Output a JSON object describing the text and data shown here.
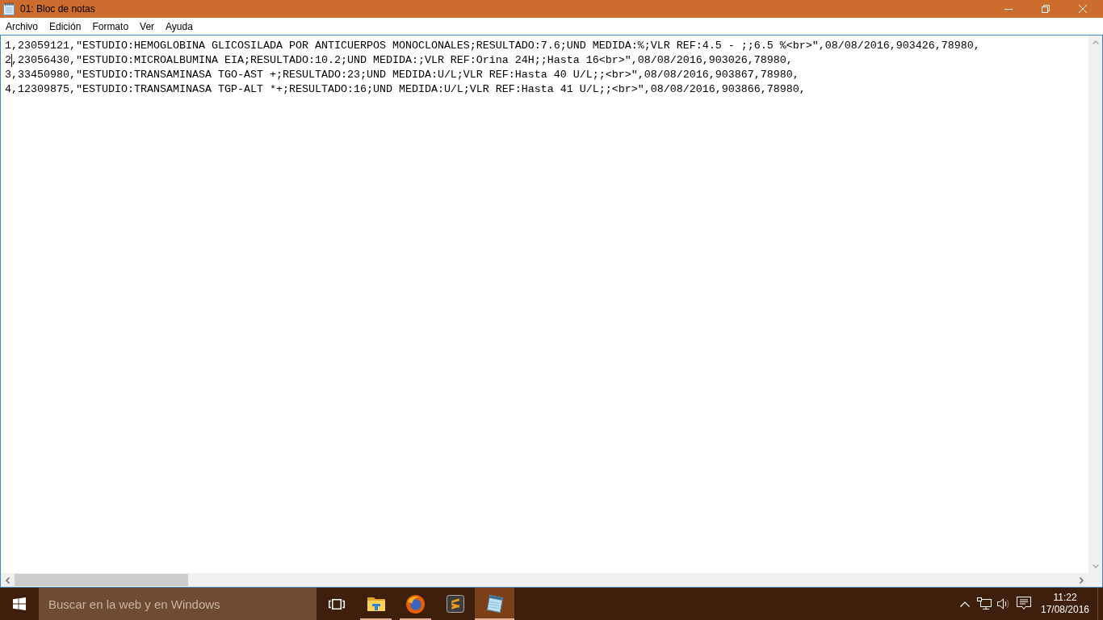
{
  "window": {
    "title": "01: Bloc de notas"
  },
  "menu": [
    "Archivo",
    "Edición",
    "Formato",
    "Ver",
    "Ayuda"
  ],
  "document": {
    "lines": [
      {
        "text": "1,23059121,\"ESTUDIO:HEMOGLOBINA GLICOSILADA POR ANTICUERPOS MONOCLONALES;RESULTADO:7.6;UND MEDIDA:%;VLR REF:4.5 - ;;6.5 %<br>\",08/08/2016,903426,78980,",
        "caret": false
      },
      {
        "text": "2,23056430,\"ESTUDIO:MICROALBUMINA EIA;RESULTADO:10.2;UND MEDIDA:;VLR REF:Orina 24H;;Hasta 16<br>\",08/08/2016,903026,78980,",
        "caret": true
      },
      {
        "text": "3,33450980,\"ESTUDIO:TRANSAMINASA TGO-AST +;RESULTADO:23;UND MEDIDA:U/L;VLR REF:Hasta 40 U/L;;<br>\",08/08/2016,903867,78980,",
        "caret": false
      },
      {
        "text": "4,12309875,\"ESTUDIO:TRANSAMINASA TGP-ALT *+;RESULTADO:16;UND MEDIDA:U/L;VLR REF:Hasta 41 U/L;;<br>\",08/08/2016,903866,78980,",
        "caret": false
      }
    ]
  },
  "taskbar": {
    "search": {
      "placeholder": "Buscar en la web y en Windows"
    },
    "apps": [
      {
        "kind": "folder",
        "running": true,
        "selected": false
      },
      {
        "kind": "globe",
        "running": true,
        "selected": false
      },
      {
        "kind": "tile",
        "running": false,
        "selected": false
      },
      {
        "kind": "notepad",
        "running": true,
        "selected": true
      }
    ],
    "clock": {
      "time": "11:22",
      "date": "17/08/2016"
    }
  }
}
